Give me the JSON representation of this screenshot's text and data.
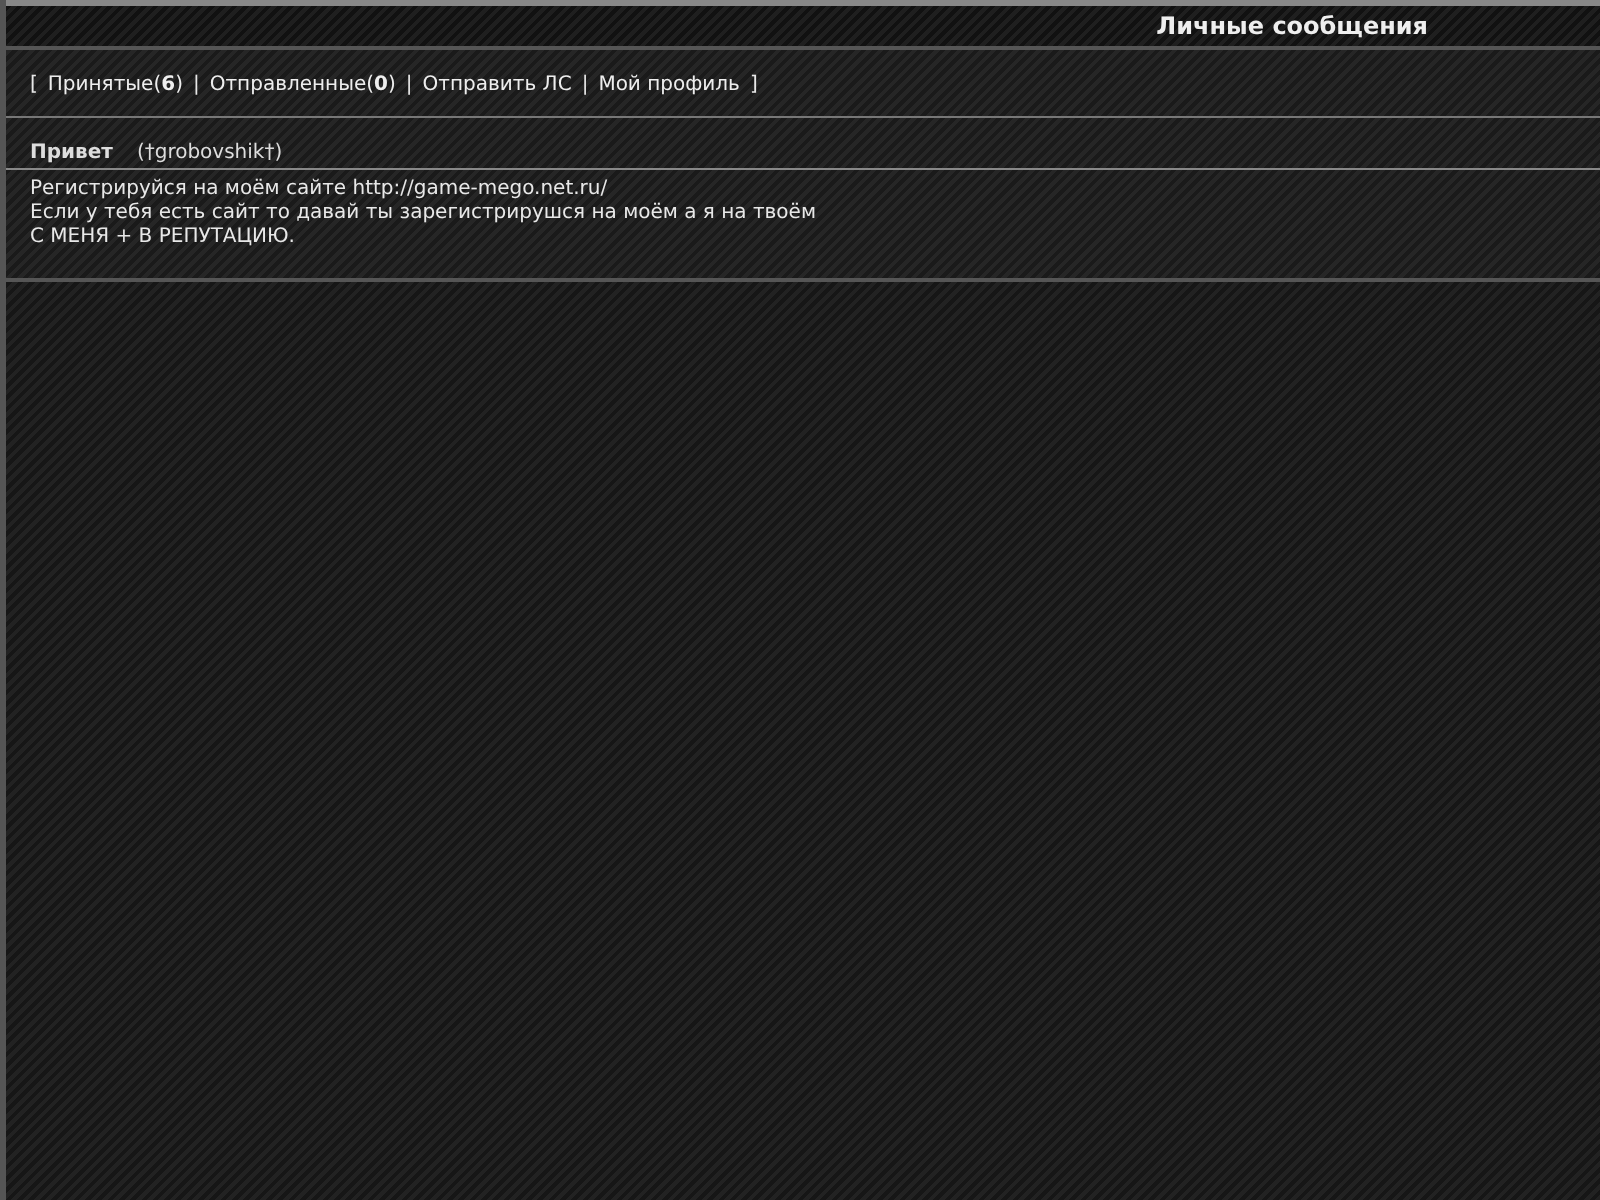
{
  "header": {
    "title": "Личные сообщения"
  },
  "nav": {
    "open": "[",
    "close": "]",
    "links": [
      {
        "label": "Принятые(**6**)"
      },
      {
        "separator": "|",
        "label": "Отправленные(**0**)"
      },
      {
        "separator": "|",
        "label": "Отправить ЛС"
      },
      {
        "separator": "|",
        "label": "Мой профиль"
      }
    ]
  },
  "message": {
    "subject": "Привет",
    "author": "(†grobovshik†)",
    "lines": [
      "Регистрируйся на моём сайте http://game-mego.net.ru/",
      "Если у тебя есть сайт то давай ты зарегистрирушся на моём а я на твоём",
      "С МЕНЯ + В РЕПУТАЦИЮ."
    ]
  }
}
